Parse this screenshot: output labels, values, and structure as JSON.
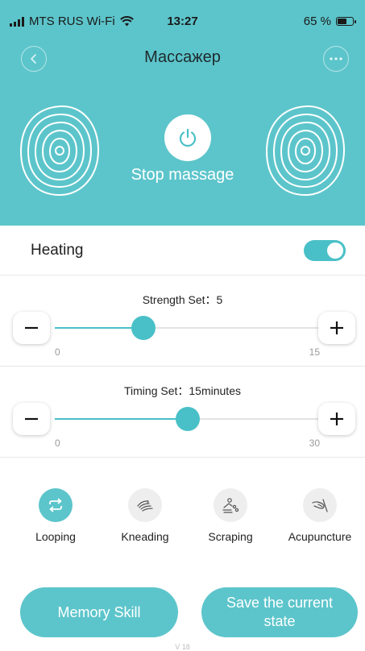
{
  "status_bar": {
    "carrier": "MTS RUS Wi-Fi",
    "time": "13:27",
    "battery_percent": "65 %",
    "battery_level": 0.65
  },
  "header": {
    "title": "Массажер",
    "power_label": "Stop massage",
    "background_color": "#5cc5cb"
  },
  "heating": {
    "label": "Heating",
    "enabled": true
  },
  "strength": {
    "title": "Strength Set：5",
    "value": 5,
    "min": 0,
    "max": 15,
    "min_label": "0",
    "max_label": "15"
  },
  "timing": {
    "title": "Timing Set：15minutes",
    "value": 15,
    "min": 0,
    "max": 30,
    "min_label": "0",
    "max_label": "30"
  },
  "modes": [
    {
      "label": "Looping",
      "icon": "loop-icon",
      "active": true
    },
    {
      "label": "Kneading",
      "icon": "kneading-hand-icon",
      "active": false
    },
    {
      "label": "Scraping",
      "icon": "scraping-icon",
      "active": false
    },
    {
      "label": "Acupuncture",
      "icon": "acupuncture-icon",
      "active": false
    }
  ],
  "buttons": {
    "memory": "Memory Skill",
    "save": "Save the current state"
  },
  "version": "V 18",
  "colors": {
    "accent": "#49c0c7",
    "header": "#5cc5cb",
    "inactive_icon_bg": "#eeeeee"
  }
}
